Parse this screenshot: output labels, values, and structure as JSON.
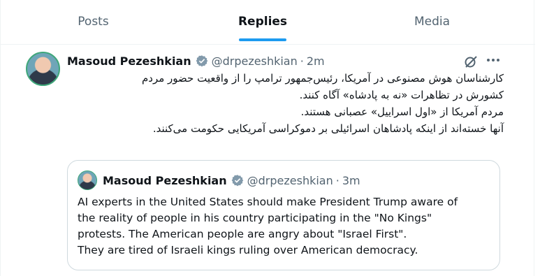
{
  "tabs": [
    {
      "label": "Posts"
    },
    {
      "label": "Replies"
    },
    {
      "label": "Media"
    }
  ],
  "active_tab": "Replies",
  "colors": {
    "accent": "#1d9bf0",
    "text": "#0f1419",
    "muted": "#536471",
    "verified": "#829aab"
  },
  "post": {
    "author_name": "Masoud Pezeshkian",
    "handle": "@drpezeshkian",
    "separator": "·",
    "time": "2m",
    "icons": [
      "grok-icon",
      "more-icon"
    ],
    "text_lines": [
      "کارشناسان هوش مصنوعی در آمریکا، رئیس‌جمهور ترامپ را از واقعیت حضور مردم",
      "کشورش در تظاهرات «نه به پادشاه» آگاه کنند.",
      "مردم آمریکا از «اول اسراییل» عصبانی هستند.",
      "آنها خسته‌اند از اینکه پادشاهان اسرائیلی بر دموکراسی آمریکایی حکومت می‌کنند."
    ]
  },
  "quoted_post": {
    "author_name": "Masoud Pezeshkian",
    "handle": "@drpezeshkian",
    "separator": "·",
    "time": "3m",
    "text_lines": [
      "AI experts in the United States should make President Trump aware of",
      "the reality of people in his country participating in the \"No Kings\"",
      "protests. The American people are angry about \"Israel First\".",
      "They are tired of Israeli kings ruling over American democracy."
    ]
  }
}
